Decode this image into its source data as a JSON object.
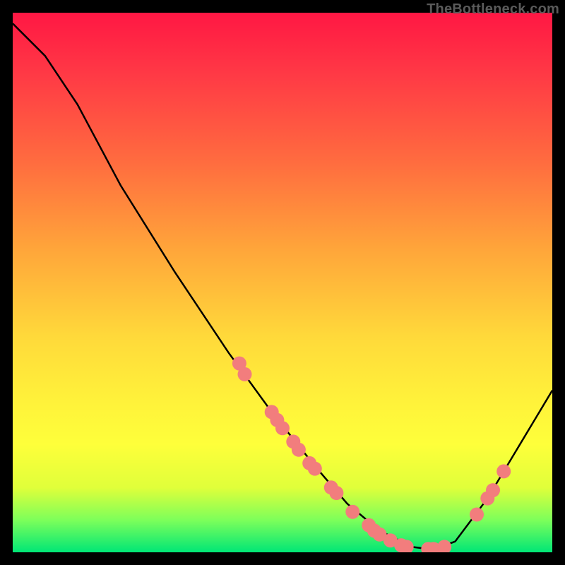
{
  "watermark": "TheBottleneck.com",
  "chart_data": {
    "type": "line",
    "title": "",
    "xlabel": "",
    "ylabel": "",
    "xlim": [
      0,
      100
    ],
    "ylim": [
      0,
      100
    ],
    "curve": [
      {
        "x": 0,
        "y": 98
      },
      {
        "x": 6,
        "y": 92
      },
      {
        "x": 12,
        "y": 83
      },
      {
        "x": 20,
        "y": 68
      },
      {
        "x": 30,
        "y": 52
      },
      {
        "x": 40,
        "y": 37
      },
      {
        "x": 48,
        "y": 26
      },
      {
        "x": 56,
        "y": 16
      },
      {
        "x": 62,
        "y": 9
      },
      {
        "x": 68,
        "y": 4
      },
      {
        "x": 74,
        "y": 1
      },
      {
        "x": 78,
        "y": 0.5
      },
      {
        "x": 82,
        "y": 2
      },
      {
        "x": 88,
        "y": 10
      },
      {
        "x": 94,
        "y": 20
      },
      {
        "x": 100,
        "y": 30
      }
    ],
    "markers": [
      {
        "x": 42,
        "y": 35
      },
      {
        "x": 43,
        "y": 33
      },
      {
        "x": 48,
        "y": 26
      },
      {
        "x": 49,
        "y": 24.5
      },
      {
        "x": 50,
        "y": 23
      },
      {
        "x": 52,
        "y": 20.5
      },
      {
        "x": 53,
        "y": 19
      },
      {
        "x": 55,
        "y": 16.5
      },
      {
        "x": 56,
        "y": 15.5
      },
      {
        "x": 59,
        "y": 12
      },
      {
        "x": 60,
        "y": 11
      },
      {
        "x": 63,
        "y": 7.5
      },
      {
        "x": 66,
        "y": 5
      },
      {
        "x": 67,
        "y": 4
      },
      {
        "x": 68,
        "y": 3.3
      },
      {
        "x": 70,
        "y": 2.2
      },
      {
        "x": 72,
        "y": 1.3
      },
      {
        "x": 73,
        "y": 1
      },
      {
        "x": 77,
        "y": 0.6
      },
      {
        "x": 78,
        "y": 0.6
      },
      {
        "x": 80,
        "y": 1
      },
      {
        "x": 86,
        "y": 7
      },
      {
        "x": 88,
        "y": 10
      },
      {
        "x": 89,
        "y": 11.5
      },
      {
        "x": 91,
        "y": 15
      }
    ],
    "marker_color": "#f27d7d",
    "marker_radius": 10,
    "line_color": "#000000",
    "line_width": 2.5
  }
}
